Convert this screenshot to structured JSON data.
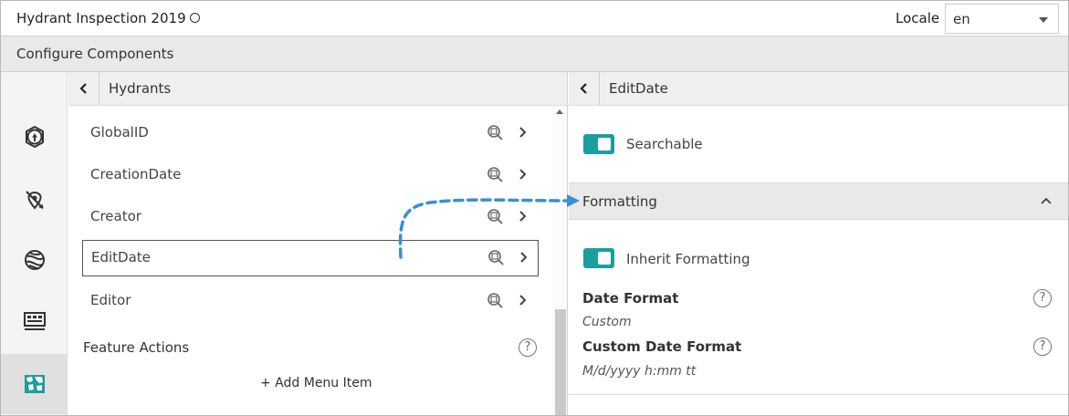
{
  "app": {
    "title": "Hydrant Inspection 2019"
  },
  "locale": {
    "label": "Locale",
    "value": "en"
  },
  "config_bar": {
    "title": "Configure Components"
  },
  "sidebar": {
    "items": [
      {
        "icon": "map-pin-icon",
        "active": false
      },
      {
        "icon": "no-location-icon",
        "active": false
      },
      {
        "icon": "globe-icon",
        "active": false
      },
      {
        "icon": "panel-list-icon",
        "active": false
      },
      {
        "icon": "map-icon",
        "active": true
      }
    ]
  },
  "middle_panel": {
    "title": "Hydrants",
    "fields": [
      {
        "label": "GlobalID",
        "selected": false
      },
      {
        "label": "CreationDate",
        "selected": false
      },
      {
        "label": "Creator",
        "selected": false
      },
      {
        "label": "EditDate",
        "selected": true
      },
      {
        "label": "Editor",
        "selected": false
      }
    ],
    "feature_actions": {
      "title": "Feature Actions",
      "help": "?"
    },
    "add_menu_item": "+ Add Menu Item"
  },
  "right_panel": {
    "title": "EditDate",
    "searchable": {
      "label": "Searchable",
      "on": true
    },
    "formatting": {
      "title": "Formatting",
      "inherit": {
        "label": "Inherit Formatting",
        "on": true
      },
      "date_format": {
        "label": "Date Format",
        "value": "Custom",
        "help": "?"
      },
      "custom_date_format": {
        "label": "Custom Date Format",
        "value": "M/d/yyyy h:mm tt",
        "help": "?"
      }
    }
  },
  "colors": {
    "accent": "#1a9e9e",
    "arrow": "#3a8fd4"
  }
}
